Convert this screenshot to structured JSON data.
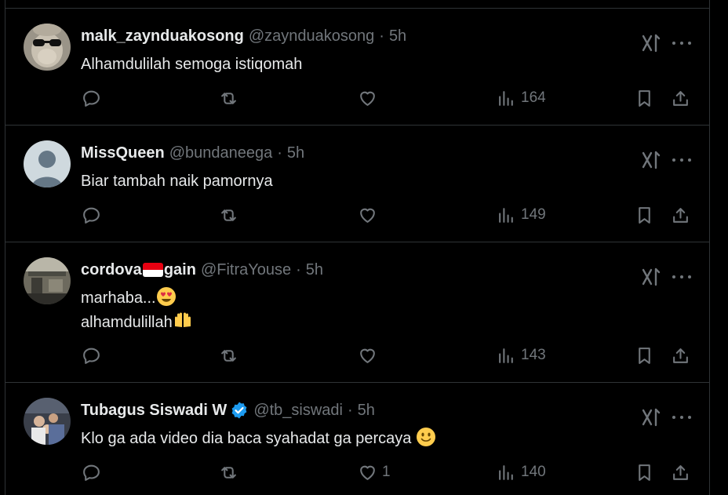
{
  "tweets": [
    {
      "name": "malk_zaynduakosong",
      "handle": "@zaynduakosong",
      "time": "5h",
      "lines": [
        "Alhamdulilah semoga istiqomah"
      ],
      "likes": "",
      "views": "164",
      "avatar": "monkey-sunglasses-avatar"
    },
    {
      "name": "MissQueen",
      "handle": "@bundaneega",
      "time": "5h",
      "lines": [
        "Biar tambah naik pamornya"
      ],
      "likes": "",
      "views": "149",
      "avatar": "default-avatar"
    },
    {
      "name_part1": "cordova",
      "name_part2": "gain",
      "handle": "@FitraYouse",
      "time": "5h",
      "lines": [
        "marhaba...",
        "alhamdulillah"
      ],
      "likes": "",
      "views": "143",
      "avatar": "photo-avatar"
    },
    {
      "name": "Tubagus Siswadi W",
      "handle": "@tb_siswadi",
      "time": "5h",
      "lines": [
        "Klo ga ada video dia baca syahadat ga percaya"
      ],
      "likes": "1",
      "views": "140",
      "avatar": "family-photo-avatar"
    }
  ],
  "separator": "·",
  "colors": {
    "background": "#000000",
    "text": "#e7e9ea",
    "muted": "#71767b",
    "border": "#2f3336",
    "verified": "#1d9bf0"
  },
  "icons": [
    "reply-icon",
    "repost-icon",
    "like-icon",
    "views-icon",
    "bookmark-icon",
    "share-icon",
    "grok-icon",
    "more-icon",
    "verified-badge-icon",
    "indonesia-flag-emoji",
    "heart-eyes-emoji",
    "raising-hands-emoji",
    "smiling-face-emoji"
  ]
}
